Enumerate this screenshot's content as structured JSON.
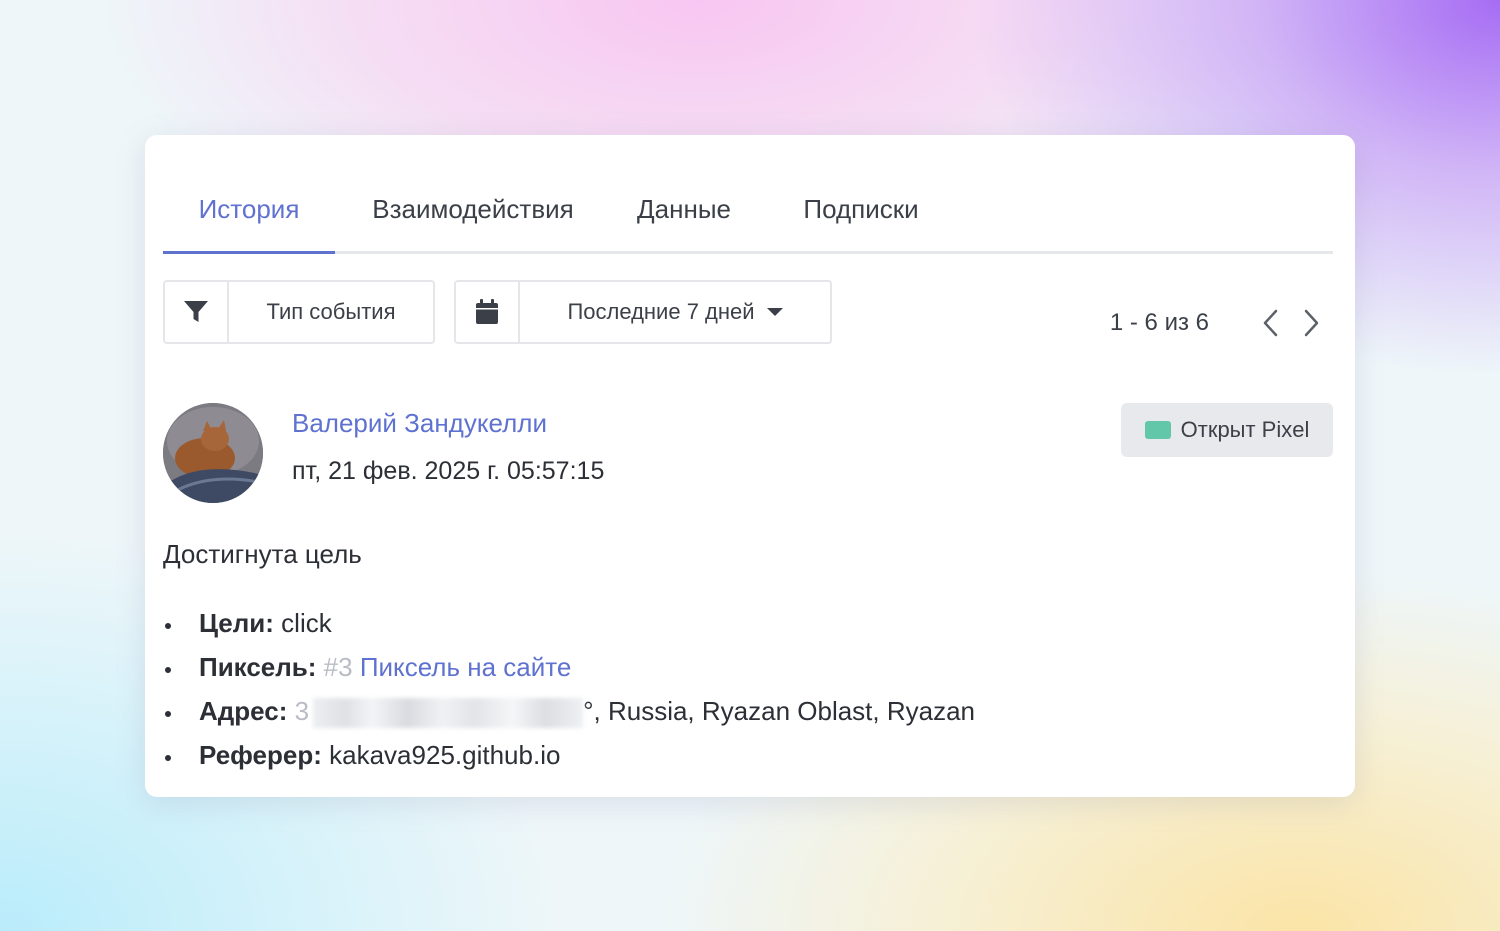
{
  "tabs": [
    {
      "label": "История",
      "active": true
    },
    {
      "label": "Взаимодействия",
      "active": false
    },
    {
      "label": "Данные",
      "active": false
    },
    {
      "label": "Подписки",
      "active": false
    }
  ],
  "filters": {
    "event_type": {
      "label": "Тип события",
      "icon": "funnel-icon"
    },
    "period": {
      "label": "Последние 7 дней",
      "icon": "calendar-icon"
    }
  },
  "pagination": {
    "summary": "1 - 6 из 6",
    "prev_icon": "chevron-left-icon",
    "next_icon": "chevron-right-icon"
  },
  "event": {
    "author": "Валерий Зандукелли",
    "timestamp": "пт, 21 фев. 2025 г. 05:57:15",
    "badge": {
      "label": "Открыт Pixel",
      "color": "#62c7a8"
    },
    "title": "Достигнута цель",
    "details": {
      "goals_key": "Цели:",
      "goals_value": "click",
      "pixel_key": "Пиксель:",
      "pixel_id": "#3",
      "pixel_name": "Пиксель на сайте",
      "address_key": "Адрес:",
      "address_visible_prefix": "3",
      "address_suffix": "°, Russia, Ryazan Oblast, Ryazan",
      "referrer_key": "Реферер:",
      "referrer_value": "kakava925.github.io"
    }
  },
  "colors": {
    "accent": "#5f72d0",
    "text": "#2c2f36"
  }
}
